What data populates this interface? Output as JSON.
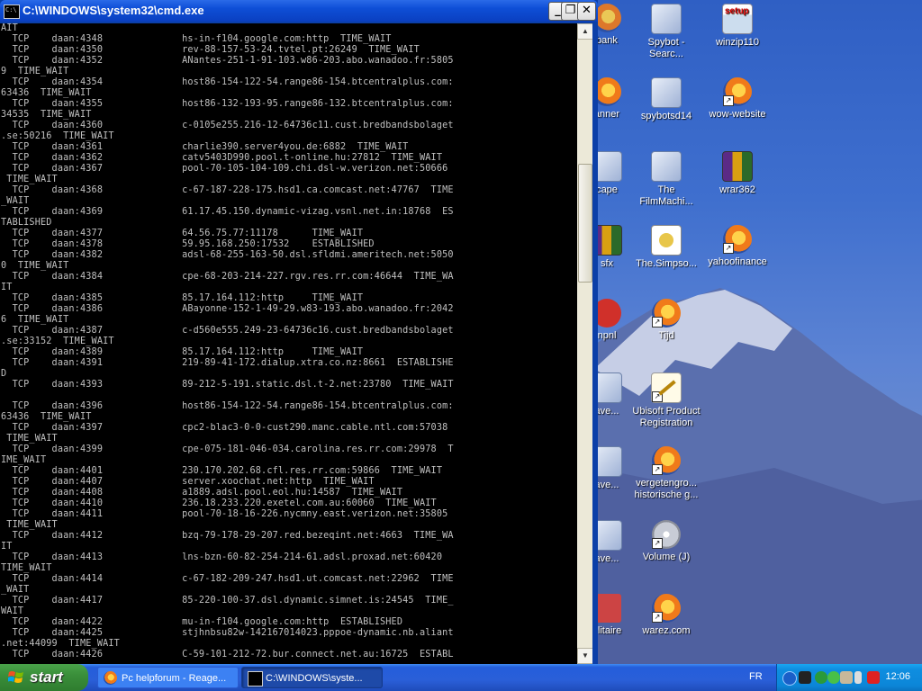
{
  "window": {
    "title": "C:\\WINDOWS\\system32\\cmd.exe",
    "minimize": "_",
    "restore": "❐",
    "close": "✕"
  },
  "console_text": "AIT\n  TCP    daan:4348              hs-in-f104.google.com:http  TIME_WAIT\n  TCP    daan:4350              rev-88-157-53-24.tvtel.pt:26249  TIME_WAIT\n  TCP    daan:4352              ANantes-251-1-91-103.w86-203.abo.wanadoo.fr:5805\n9  TIME_WAIT\n  TCP    daan:4354              host86-154-122-54.range86-154.btcentralplus.com:\n63436  TIME_WAIT\n  TCP    daan:4355              host86-132-193-95.range86-132.btcentralplus.com:\n34535  TIME_WAIT\n  TCP    daan:4360              c-0105e255.216-12-64736c11.cust.bredbandsbolaget\n.se:50216  TIME_WAIT\n  TCP    daan:4361              charlie390.server4you.de:6882  TIME_WAIT\n  TCP    daan:4362              catv5403D990.pool.t-online.hu:27812  TIME_WAIT\n  TCP    daan:4367              pool-70-105-104-109.chi.dsl-w.verizon.net:50666\n TIME_WAIT\n  TCP    daan:4368              c-67-187-228-175.hsd1.ca.comcast.net:47767  TIME\n_WAIT\n  TCP    daan:4369              61.17.45.150.dynamic-vizag.vsnl.net.in:18768  ES\nTABLISHED\n  TCP    daan:4377              64.56.75.77:11178      TIME_WAIT\n  TCP    daan:4378              59.95.168.250:17532    ESTABLISHED\n  TCP    daan:4382              adsl-68-255-163-50.dsl.sfldmi.ameritech.net:5050\n0  TIME_WAIT\n  TCP    daan:4384              cpe-68-203-214-227.rgv.res.rr.com:46644  TIME_WA\nIT\n  TCP    daan:4385              85.17.164.112:http     TIME_WAIT\n  TCP    daan:4386              ABayonne-152-1-49-29.w83-193.abo.wanadoo.fr:2042\n6  TIME_WAIT\n  TCP    daan:4387              c-d560e555.249-23-64736c16.cust.bredbandsbolaget\n.se:33152  TIME_WAIT\n  TCP    daan:4389              85.17.164.112:http     TIME_WAIT\n  TCP    daan:4391              219-89-41-172.dialup.xtra.co.nz:8661  ESTABLISHE\nD\n  TCP    daan:4393              89-212-5-191.static.dsl.t-2.net:23780  TIME_WAIT\n\n  TCP    daan:4396              host86-154-122-54.range86-154.btcentralplus.com:\n63436  TIME_WAIT\n  TCP    daan:4397              cpc2-blac3-0-0-cust290.manc.cable.ntl.com:57038\n TIME_WAIT\n  TCP    daan:4399              cpe-075-181-046-034.carolina.res.rr.com:29978  T\nIME_WAIT\n  TCP    daan:4401              230.170.202.68.cfl.res.rr.com:59866  TIME_WAIT\n  TCP    daan:4407              server.xoochat.net:http  TIME_WAIT\n  TCP    daan:4408              a1889.adsl.pool.eol.hu:14587  TIME_WAIT\n  TCP    daan:4410              236.18.233.220.exetel.com.au:60060  TIME_WAIT\n  TCP    daan:4411              pool-70-18-16-226.nycmny.east.verizon.net:35805\n TIME_WAIT\n  TCP    daan:4412              bzq-79-178-29-207.red.bezeqint.net:4663  TIME_WA\nIT\n  TCP    daan:4413              lns-bzn-60-82-254-214-61.adsl.proxad.net:60420\nTIME_WAIT\n  TCP    daan:4414              c-67-182-209-247.hsd1.ut.comcast.net:22962  TIME\n_WAIT\n  TCP    daan:4417              85-220-100-37.dsl.dynamic.simnet.is:24545  TIME_\nWAIT\n  TCP    daan:4422              mu-in-f104.google.com:http  ESTABLISHED\n  TCP    daan:4425              stjhnbsu82w-142167014023.pppoe-dynamic.nb.aliant\n.net:44099  TIME_WAIT\n  TCP    daan:4426              C-59-101-212-72.bur.connect.net.au:16725  ESTABL",
  "desktop_icons": [
    {
      "label": "bank",
      "icon": "generic-icon"
    },
    {
      "label": "Spybot - Searc...",
      "icon": "spybot-icon"
    },
    {
      "label": "winzip110",
      "icon": "setup-icon"
    },
    {
      "label": "anner",
      "icon": "generic-icon"
    },
    {
      "label": "spybotsd14",
      "icon": "spybot-installer-icon"
    },
    {
      "label": "wow-website",
      "icon": "firefox-shortcut-icon"
    },
    {
      "label": "cape",
      "icon": "generic-icon"
    },
    {
      "label": "The FilmMachi...",
      "icon": "installer-icon"
    },
    {
      "label": "wrar362",
      "icon": "winrar-icon"
    },
    {
      "label": "sfx",
      "icon": "generic-icon"
    },
    {
      "label": "The.Simpso...",
      "icon": "document-icon"
    },
    {
      "label": "yahoofinance",
      "icon": "firefox-shortcut-icon"
    },
    {
      "label": "npnl",
      "icon": "generic-icon"
    },
    {
      "label": "Tijd",
      "icon": "firefox-shortcut-icon"
    },
    {
      "label": "ave...",
      "icon": "generic-icon"
    },
    {
      "label": "Ubisoft Product Registration",
      "icon": "pen-document-icon"
    },
    {
      "label": "ave...",
      "icon": "generic-icon"
    },
    {
      "label": "vergetengro... historische g...",
      "icon": "firefox-shortcut-icon"
    },
    {
      "label": "ave...",
      "icon": "generic-icon"
    },
    {
      "label": "Volume (J)",
      "icon": "drive-icon"
    },
    {
      "label": "olitaire",
      "icon": "generic-icon"
    },
    {
      "label": "warez.com",
      "icon": "firefox-shortcut-icon"
    }
  ],
  "taskbar": {
    "start_label": "start",
    "tasks": [
      {
        "label": "Pc helpforum - Reage..."
      },
      {
        "label": "C:\\WINDOWS\\syste..."
      }
    ],
    "language": "FR",
    "clock": "12:06"
  }
}
